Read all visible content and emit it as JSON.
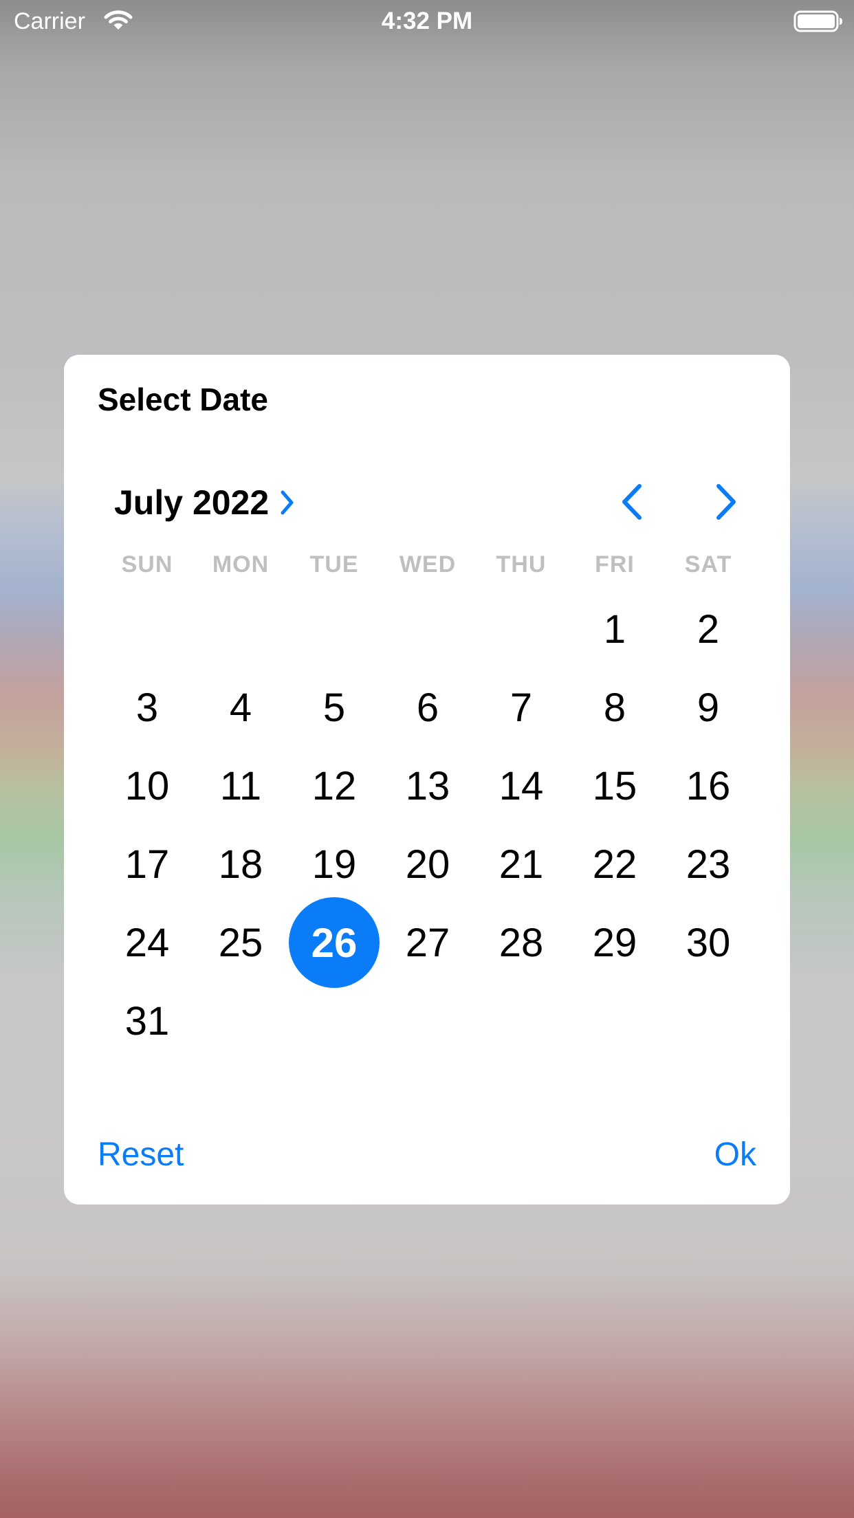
{
  "status_bar": {
    "carrier": "Carrier",
    "time": "4:32 PM"
  },
  "dialog": {
    "title": "Select Date",
    "month_label": "July 2022",
    "weekdays": [
      "SUN",
      "MON",
      "TUE",
      "WED",
      "THU",
      "FRI",
      "SAT"
    ],
    "weeks": [
      [
        "",
        "",
        "",
        "",
        "",
        "1",
        "2"
      ],
      [
        "3",
        "4",
        "5",
        "6",
        "7",
        "8",
        "9"
      ],
      [
        "10",
        "11",
        "12",
        "13",
        "14",
        "15",
        "16"
      ],
      [
        "17",
        "18",
        "19",
        "20",
        "21",
        "22",
        "23"
      ],
      [
        "24",
        "25",
        "26",
        "27",
        "28",
        "29",
        "30"
      ],
      [
        "31",
        "",
        "",
        "",
        "",
        "",
        ""
      ]
    ],
    "selected_day": "26",
    "reset_label": "Reset",
    "ok_label": "Ok",
    "accent_color": "#0b7cf7"
  }
}
